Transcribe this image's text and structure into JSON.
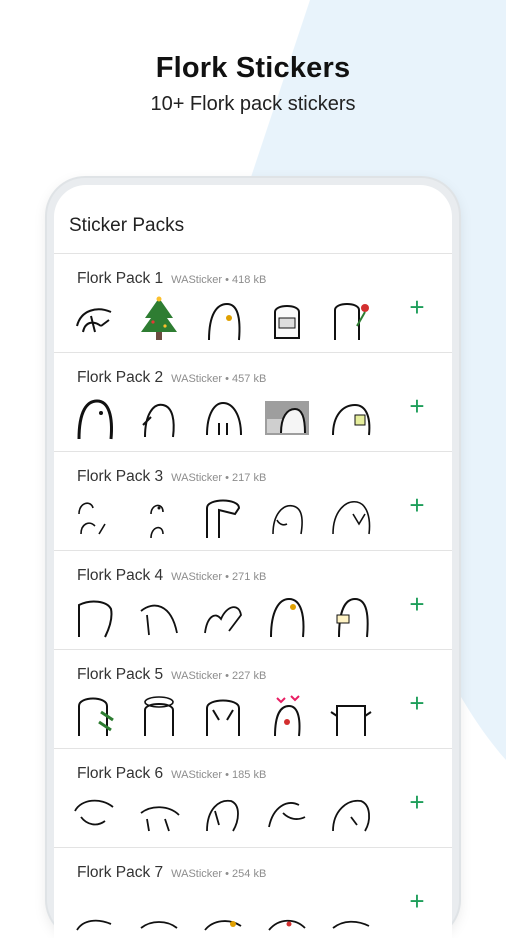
{
  "promo": {
    "title": "Flork Stickers",
    "subtitle": "10+ Flork pack stickers"
  },
  "app": {
    "title": "Sticker Packs"
  },
  "colors": {
    "accent": "#1e9e5a",
    "background_shape": "#e8f3fb"
  },
  "packs": [
    {
      "name": "Flork Pack 1",
      "meta": "WASticker • 418 kB",
      "add_icon": "+"
    },
    {
      "name": "Flork Pack 2",
      "meta": "WASticker • 457 kB",
      "add_icon": "+"
    },
    {
      "name": "Flork Pack 3",
      "meta": "WASticker • 217 kB",
      "add_icon": "+"
    },
    {
      "name": "Flork Pack 4",
      "meta": "WASticker • 271 kB",
      "add_icon": "+"
    },
    {
      "name": "Flork Pack 5",
      "meta": "WASticker • 227 kB",
      "add_icon": "+"
    },
    {
      "name": "Flork Pack 6",
      "meta": "WASticker • 185 kB",
      "add_icon": "+"
    },
    {
      "name": "Flork Pack 7",
      "meta": "WASticker • 254 kB",
      "add_icon": "+"
    }
  ]
}
